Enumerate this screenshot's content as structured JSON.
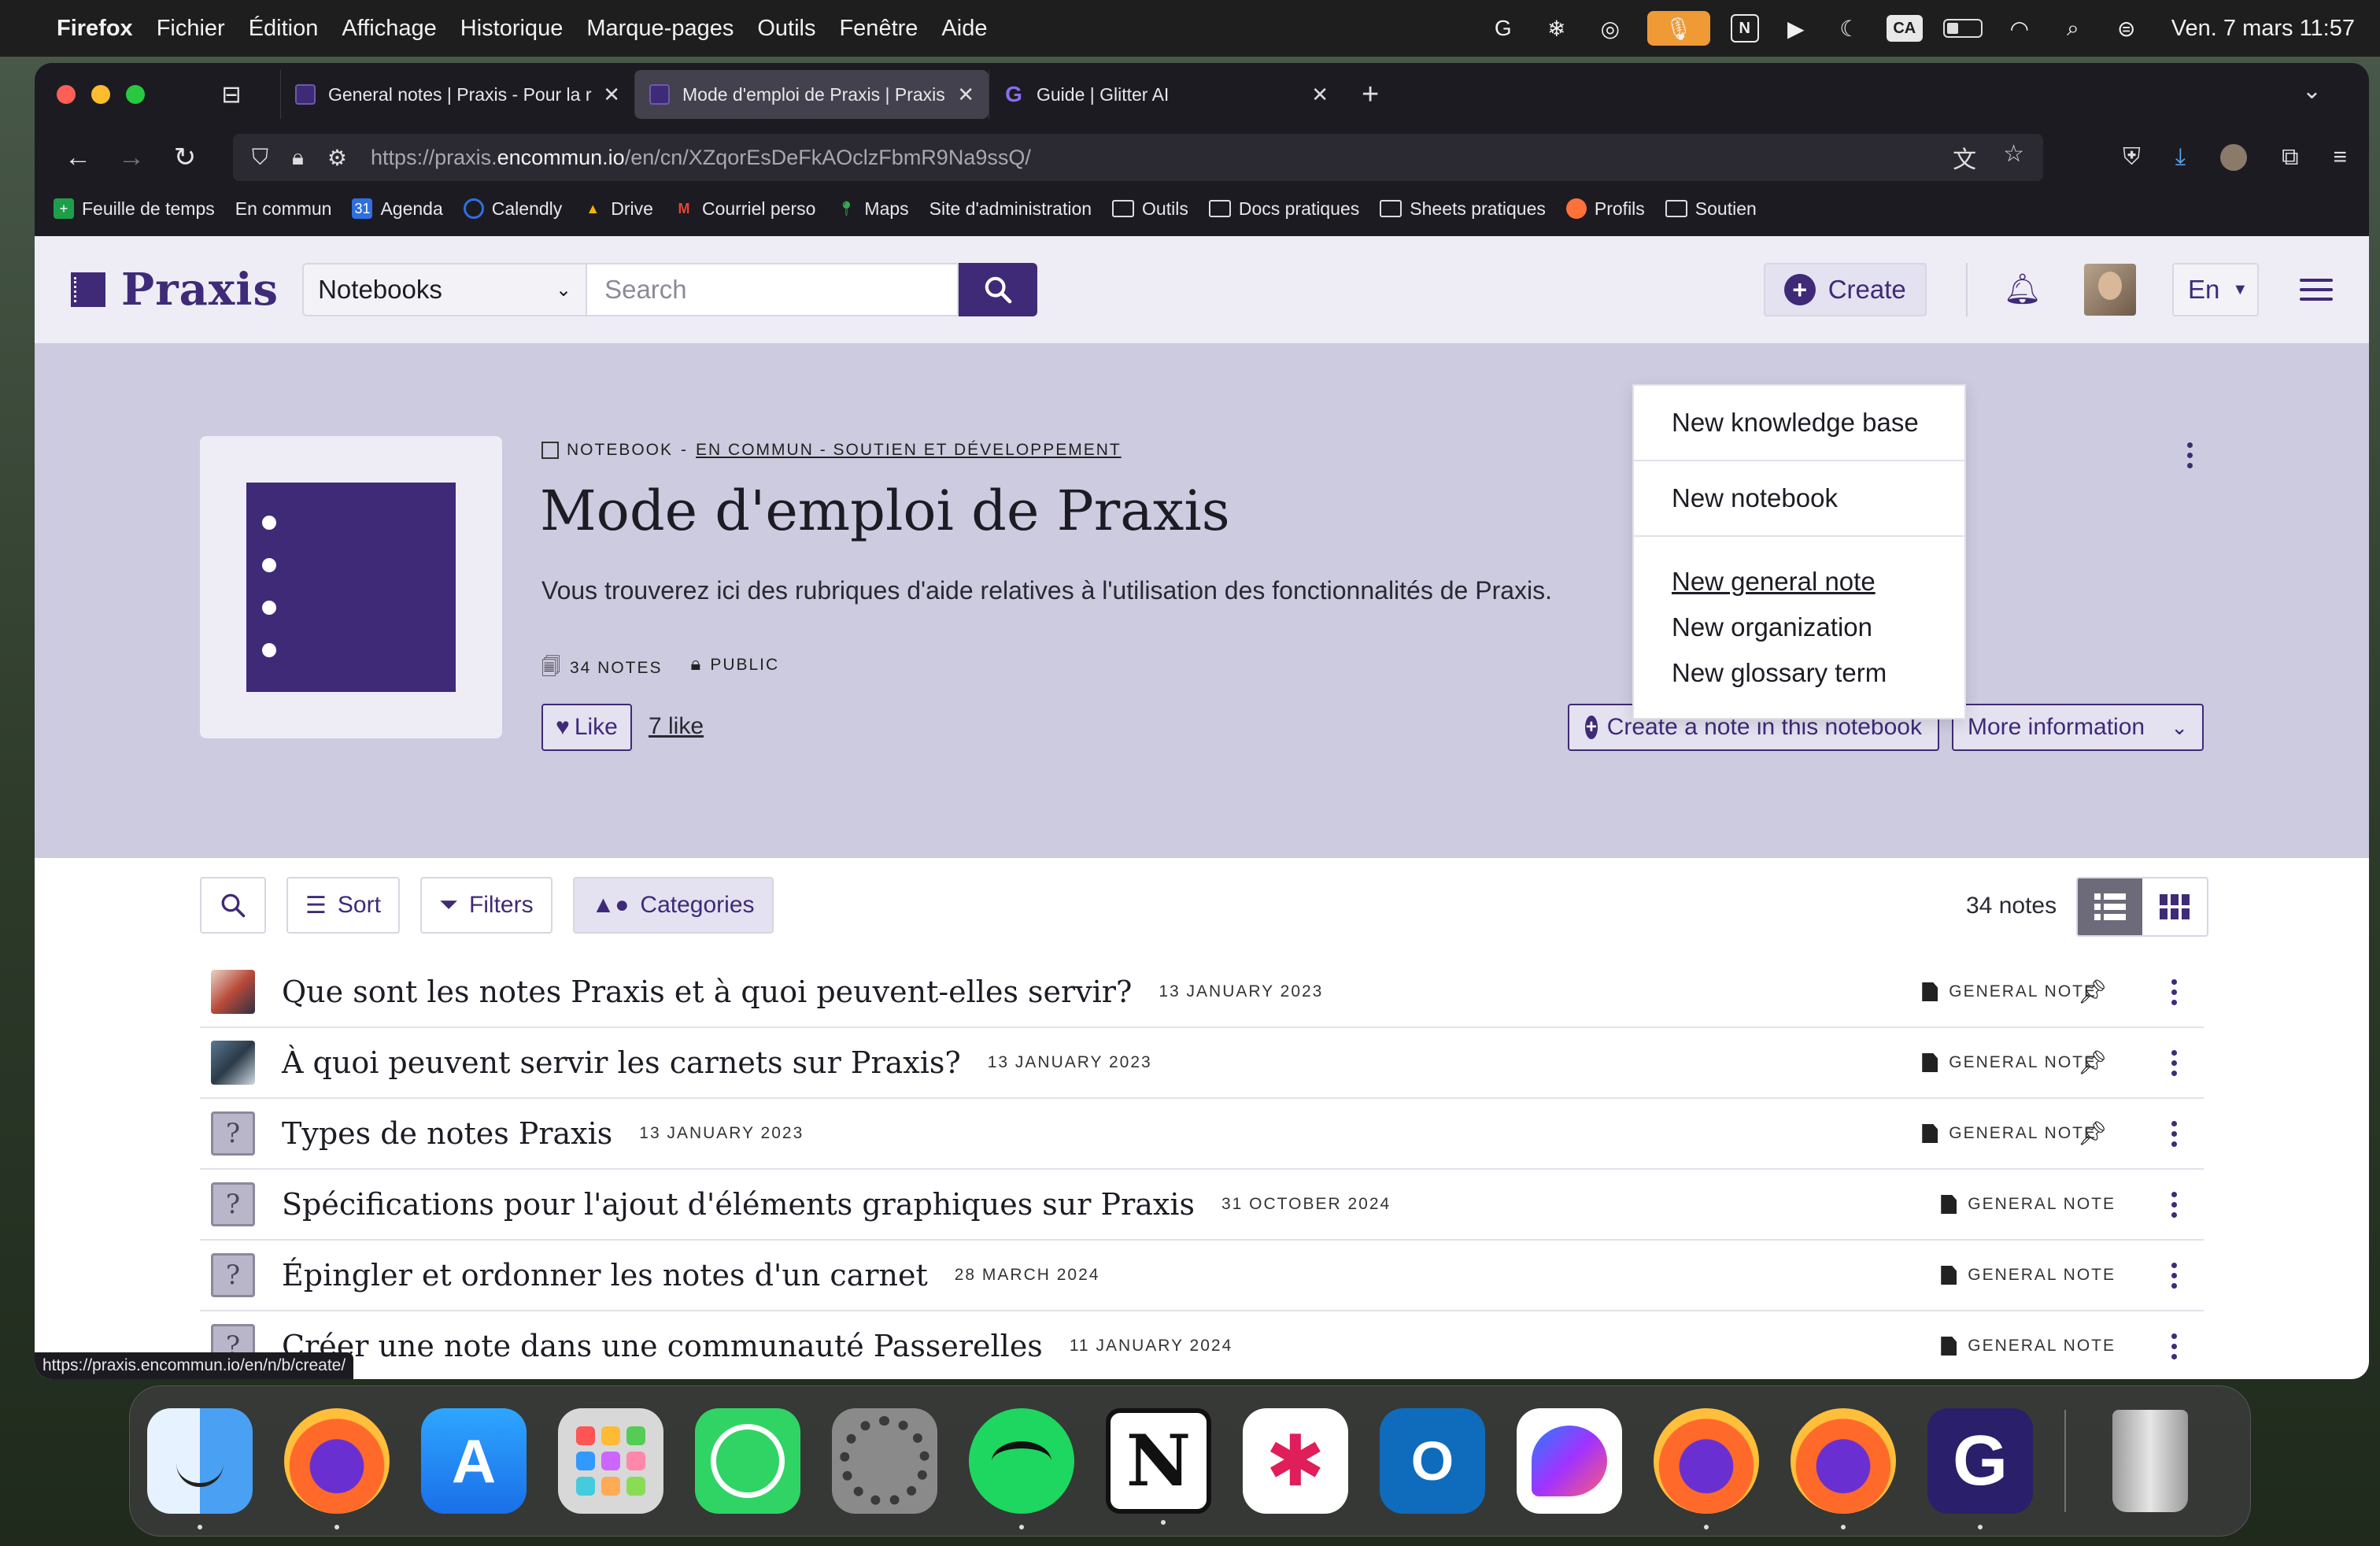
{
  "menubar": {
    "app_name": "Firefox",
    "menus": [
      "Fichier",
      "Édition",
      "Affichage",
      "Historique",
      "Marque-pages",
      "Outils",
      "Fenêtre",
      "Aide"
    ],
    "status_icons": [
      "grammarly-icon",
      "snowflake-icon",
      "swirl-icon",
      "microphone-icon",
      "notion-icon",
      "play-icon",
      "moon-icon",
      "input-source-icon",
      "battery-icon",
      "wifi-icon",
      "spotlight-icon",
      "control-center-icon"
    ],
    "input_source": "CA",
    "clock": "Ven. 7 mars 11:57"
  },
  "browser": {
    "tabs": [
      {
        "label": "General notes | Praxis - Pour la r",
        "active": false
      },
      {
        "label": "Mode d'emploi de Praxis | Praxis",
        "active": true
      },
      {
        "label": "Guide | Glitter AI",
        "active": false
      }
    ],
    "url_prefix": "https://praxis.",
    "url_host": "encommun.io",
    "url_path": "/en/cn/XZqorEsDeFkAOclzFbmR9Na9ssQ/",
    "bookmarks": [
      "Feuille de temps",
      "En commun",
      "Agenda",
      "Calendly",
      "Drive",
      "Courriel perso",
      "Maps",
      "Site d'administration",
      "Outils",
      "Docs pratiques",
      "Sheets pratiques",
      "Profils",
      "Soutien"
    ],
    "status_url": "https://praxis.encommun.io/en/n/b/create/"
  },
  "site": {
    "logo": "Praxis",
    "search_scope": "Notebooks",
    "search_placeholder": "Search",
    "create_label": "Create",
    "lang": "En"
  },
  "dropdown": {
    "items": [
      "New knowledge base",
      "New notebook",
      "New general note",
      "New organization",
      "New glossary term"
    ]
  },
  "notebook": {
    "crumb_type": "NOTEBOOK",
    "crumb_sep": "-",
    "crumb_community": "EN COMMUN - SOUTIEN ET DÉVELOPPEMENT",
    "title": "Mode d'emploi de Praxis",
    "description": "Vous trouverez ici des rubriques d'aide relatives à l'utilisation des fonctionnalités de Praxis.",
    "notes_count": "34 NOTES",
    "visibility": "PUBLIC",
    "like_label": "Like",
    "like_count": "7 like",
    "create_note_label": "Create a note in this notebook",
    "more_info_label": "More information"
  },
  "toolbar": {
    "sort": "Sort",
    "filters": "Filters",
    "categories": "Categories",
    "count": "34 notes"
  },
  "notes": [
    {
      "title": "Que sont les notes Praxis et à quoi peuvent-elles servir?",
      "date": "13 JANUARY 2023",
      "type": "GENERAL NOTE",
      "pinned": true
    },
    {
      "title": "À quoi peuvent servir les carnets sur Praxis?",
      "date": "13 JANUARY 2023",
      "type": "GENERAL NOTE",
      "pinned": true
    },
    {
      "title": "Types de notes Praxis",
      "date": "13 JANUARY 2023",
      "type": "GENERAL NOTE",
      "pinned": true
    },
    {
      "title": "Spécifications pour l'ajout d'éléments graphiques sur Praxis",
      "date": "31 OCTOBER 2024",
      "type": "GENERAL NOTE",
      "pinned": false
    },
    {
      "title": "Épingler et ordonner les notes d'un carnet",
      "date": "28 MARCH 2024",
      "type": "GENERAL NOTE",
      "pinned": false
    },
    {
      "title": "Créer une note dans une communauté Passerelles",
      "date": "11 JANUARY 2024",
      "type": "GENERAL NOTE",
      "pinned": false
    }
  ],
  "dock": [
    "Finder",
    "Firefox",
    "App Store",
    "Launchpad",
    "WhatsApp",
    "System Settings",
    "Spotify",
    "Notion",
    "Slack",
    "Outlook",
    "Messenger",
    "Firefox",
    "Firefox",
    "Glitter AI",
    "Trash"
  ],
  "colors": {
    "brand": "#3f2a78",
    "hero_bg": "#cdcbdf",
    "header_bg": "#eeedf6"
  }
}
